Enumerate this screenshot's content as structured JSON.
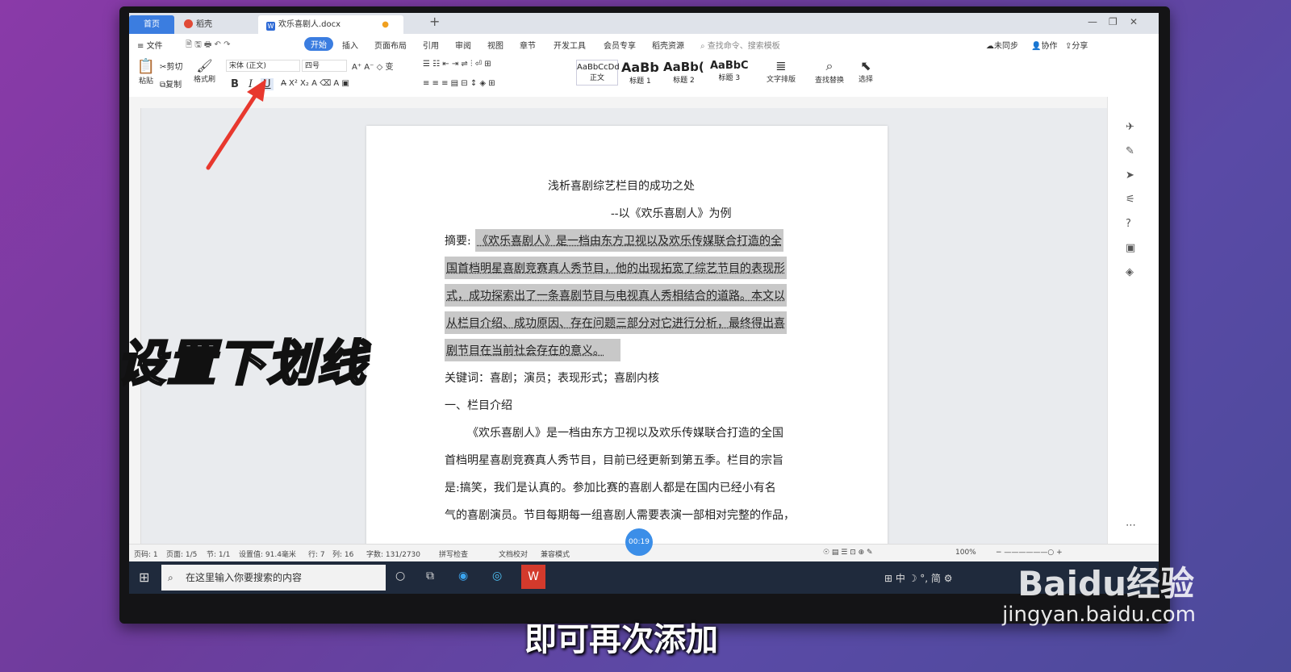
{
  "tabs": {
    "home": "首页",
    "daoke": "稻壳",
    "doc": "欢乐喜剧人.docx"
  },
  "menu": {
    "file": "文件",
    "items": [
      "开始",
      "插入",
      "页面布局",
      "引用",
      "审阅",
      "视图",
      "章节",
      "开发工具",
      "会员专享",
      "稻壳资源"
    ],
    "search": "查找命令、搜索模板",
    "sync": "未同步",
    "collab": "协作",
    "share": "分享"
  },
  "ribbon": {
    "paste": "粘贴",
    "cut": "剪切",
    "copy": "复制",
    "format_painter": "格式刷",
    "font_name": "宋体 (正文)",
    "font_size": "四号",
    "styles": [
      {
        "preview": "AaBbCcDd",
        "label": "正文"
      },
      {
        "preview": "AaBb",
        "label": "标题 1"
      },
      {
        "preview": "AaBb(",
        "label": "标题 2"
      },
      {
        "preview": "AaBbC",
        "label": "标题 3"
      }
    ],
    "text_layout": "文字排版",
    "find_replace": "查找替换",
    "select": "选择",
    "bold": "B",
    "italic": "I",
    "underline": "U"
  },
  "document": {
    "title": "浅析喜剧综艺栏目的成功之处",
    "subtitle": "--以《欢乐喜剧人》为例",
    "abstract_label": "摘要:",
    "abstract_lines": [
      "《欢乐喜剧人》是一档由东方卫视以及欢乐传媒联合打造的全",
      "国首档明星喜剧竞赛真人秀节目，他的出现拓宽了综艺节目的表现形",
      "式，成功探索出了一条喜剧节目与电视真人秀相结合的道路。本文以",
      "从栏目介绍、成功原因、存在问题三部分对它进行分析，最终得出喜",
      "剧节目在当前社会存在的意义。"
    ],
    "keywords": "关键词：喜剧；演员；表现形式；喜剧内核",
    "section1": "一、栏目介绍",
    "body_lines": [
      "《欢乐喜剧人》是一档由东方卫视以及欢乐传媒联合打造的全国",
      "首档明星喜剧竞赛真人秀节目，目前已经更新到第五季。栏目的宗旨",
      "是:搞笑，我们是认真的。参加比赛的喜剧人都是在国内已经小有名",
      "气的喜剧演员。节目每期每一组喜剧人需要表演一部相对完整的作品，"
    ]
  },
  "status": {
    "page": "页码: 1",
    "pages": "页面: 1/5",
    "section": "节: 1/1",
    "setting": "设置值: 91.4毫米",
    "row": "行: 7",
    "col": "列: 16",
    "words": "字数: 131/2730",
    "spell": "拼写检查",
    "proof": "文档校对",
    "compat": "兼容模式",
    "zoom": "100%"
  },
  "taskbar": {
    "search": "在这里输入你要搜索的内容",
    "ime": "中",
    "simp": "简"
  },
  "overlay": {
    "caption": "设置下划线",
    "subtitle": "即可再次添加",
    "watermark": "Baidu经验",
    "watermark_url": "jingyan.baidu.com",
    "timer": "00:19"
  },
  "colors": {
    "accent": "#3b7de0",
    "arrow": "#e8382e"
  }
}
